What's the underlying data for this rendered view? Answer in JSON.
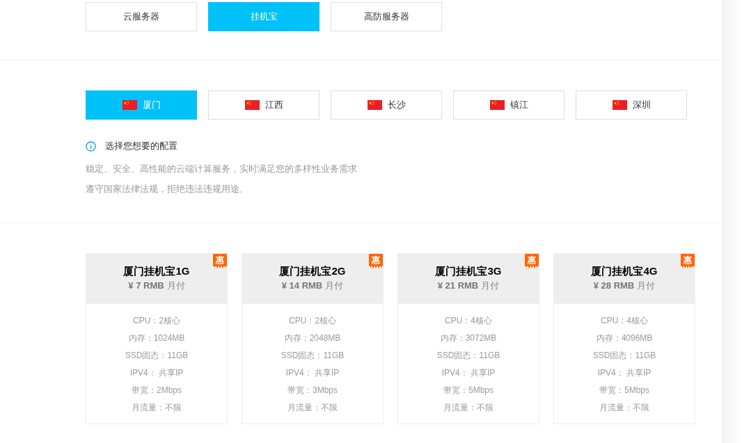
{
  "product_tabs": [
    {
      "label": "云服务器",
      "selected": false
    },
    {
      "label": "挂机宝",
      "selected": true
    },
    {
      "label": "高防服务器",
      "selected": false
    }
  ],
  "region_tabs": [
    {
      "label": "厦门",
      "selected": true
    },
    {
      "label": "江西",
      "selected": false
    },
    {
      "label": "长沙",
      "selected": false
    },
    {
      "label": "镇江",
      "selected": false
    },
    {
      "label": "深圳",
      "selected": false
    }
  ],
  "info": {
    "title": "选择您想要的配置",
    "lines": [
      "稳定、安全、高性能的云端计算服务，实时满足您的多样性业务需求",
      "遵守国家法律法规，拒绝违法违规用途。"
    ]
  },
  "plans": [
    {
      "name": "厦门挂机宝1G",
      "badge": "惠",
      "price": "¥ 7 RMB",
      "period": "月付",
      "specs": [
        "CPU：2核心",
        "内存：1024MB",
        "SSD固态：11GB",
        "IPV4： 共享IP",
        "带宽：2Mbps",
        "月流量：不限"
      ]
    },
    {
      "name": "厦门挂机宝2G",
      "badge": "惠",
      "price": "¥ 14 RMB",
      "period": "月付",
      "specs": [
        "CPU：2核心",
        "内存：2048MB",
        "SSD固态：11GB",
        "IPV4： 共享IP",
        "带宽：3Mbps",
        "月流量：不限"
      ]
    },
    {
      "name": "厦门挂机宝3G",
      "badge": "惠",
      "price": "¥ 21 RMB",
      "period": "月付",
      "specs": [
        "CPU：4核心",
        "内存：3072MB",
        "SSD固态：11GB",
        "IPV4： 共享IP",
        "带宽：5Mbps",
        "月流量：不限"
      ]
    },
    {
      "name": "厦门挂机宝4G",
      "badge": "惠",
      "price": "¥ 28 RMB",
      "period": "月付",
      "specs": [
        "CPU：4核心",
        "内存：4096MB",
        "SSD固态：11GB",
        "IPV4： 共享IP",
        "带宽：5Mbps",
        "月流量：不限"
      ]
    }
  ]
}
